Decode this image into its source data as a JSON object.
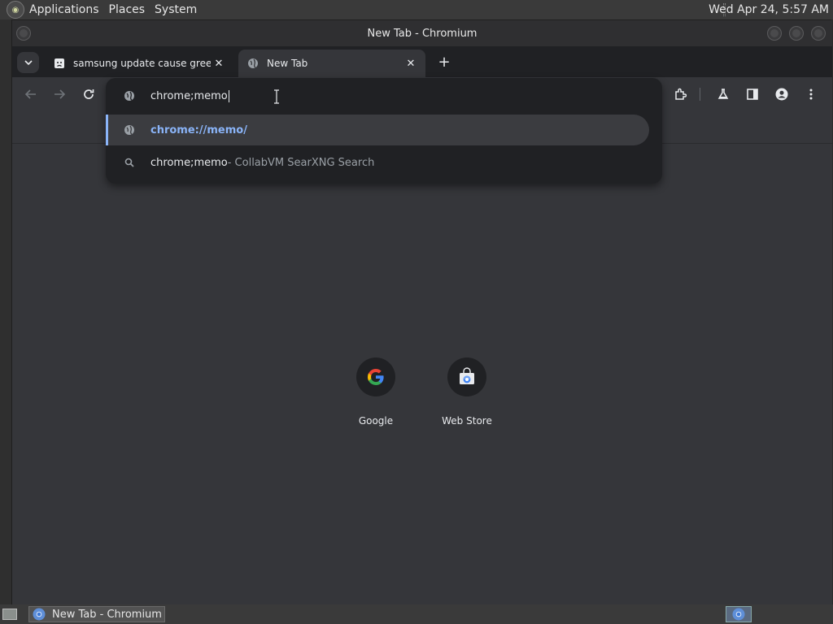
{
  "top_panel": {
    "menus": [
      "Applications",
      "Places",
      "System"
    ],
    "clock": "Wed Apr 24,  5:57 AM"
  },
  "window": {
    "title": "New Tab - Chromium"
  },
  "tabs": [
    {
      "title": "samsung update cause green",
      "favicon": "sad-face-icon",
      "active": false
    },
    {
      "title": "New Tab",
      "favicon": "globe-icon",
      "active": true
    }
  ],
  "omnibox": {
    "input_value": "chrome;memo",
    "suggestions": [
      {
        "icon": "globe-icon",
        "text": "chrome://memo/",
        "suffix": ""
      },
      {
        "icon": "search-icon",
        "text": "chrome;memo",
        "suffix": " - CollabVM SearXNG Search"
      }
    ]
  },
  "shortcuts": [
    {
      "label": "Google",
      "icon": "google-icon"
    },
    {
      "label": "Web Store",
      "icon": "web-store-icon"
    }
  ],
  "taskbar": {
    "task_label": "New Tab - Chromium"
  },
  "colors": {
    "accent": "#8ab4f8",
    "frame": "#202124",
    "toolbar": "#35363a"
  }
}
